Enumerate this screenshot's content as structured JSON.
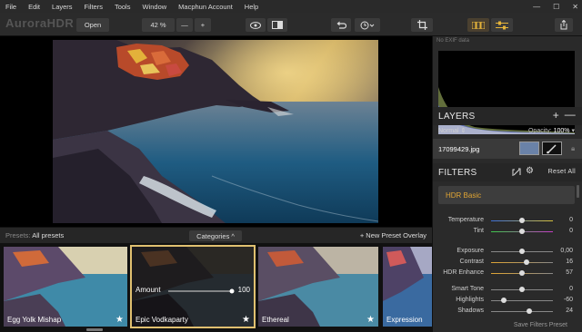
{
  "menu": [
    "File",
    "Edit",
    "Layers",
    "Filters",
    "Tools",
    "Window",
    "Macphun Account",
    "Help"
  ],
  "app_name": "AuroraHDR",
  "toolbar": {
    "open_label": "Open",
    "zoom": "42 %",
    "zoom_minus": "—",
    "zoom_plus": "+"
  },
  "exif": "No EXIF data",
  "layers": {
    "title": "LAYERS",
    "blend_mode": "Normal",
    "opacity_label": "Opacity:",
    "opacity_value": "100%",
    "file_name": "17099429.jpg"
  },
  "filters": {
    "title": "FILTERS",
    "reset_label": "Reset All",
    "section": "HDR Basic",
    "save_label": "Save Filters Preset",
    "sliders": [
      {
        "label": "Temperature",
        "value": "0",
        "fill": 0.5,
        "colors": [
          "#3c6fd8",
          "#d8c23c"
        ]
      },
      {
        "label": "Tint",
        "value": "0",
        "fill": 0.5,
        "colors": [
          "#3cc84a",
          "#c83cc8"
        ]
      },
      {
        "label": "Exposure",
        "value": "0,00",
        "fill": 0.5,
        "colors": [
          "#888",
          "#888"
        ]
      },
      {
        "label": "Contrast",
        "value": "16",
        "fill": 0.58,
        "colors": [
          "#e0a534",
          "#888"
        ]
      },
      {
        "label": "HDR Enhance",
        "value": "57",
        "fill": 0.5,
        "colors": [
          "#e0a534",
          "#888"
        ]
      },
      {
        "label": "Smart Tone",
        "value": "0",
        "fill": 0.5,
        "colors": [
          "#888",
          "#888"
        ]
      },
      {
        "label": "Highlights",
        "value": "-60",
        "fill": 0.2,
        "colors": [
          "#888",
          "#888"
        ]
      },
      {
        "label": "Shadows",
        "value": "24",
        "fill": 0.62,
        "colors": [
          "#888",
          "#888"
        ]
      }
    ]
  },
  "presets": {
    "label_prefix": "Presets:",
    "label_value": "All presets",
    "categories": "Categories ^",
    "new_preset": "+ New Preset Overlay",
    "items": [
      {
        "name": "Egg Yolk Mishap",
        "star": "★"
      },
      {
        "name": "Epic Vodkaparty",
        "star": "★",
        "amount_label": "Amount",
        "amount_value": "100"
      },
      {
        "name": "Ethereal",
        "star": "★"
      },
      {
        "name": "Expression",
        "star": ""
      }
    ]
  }
}
